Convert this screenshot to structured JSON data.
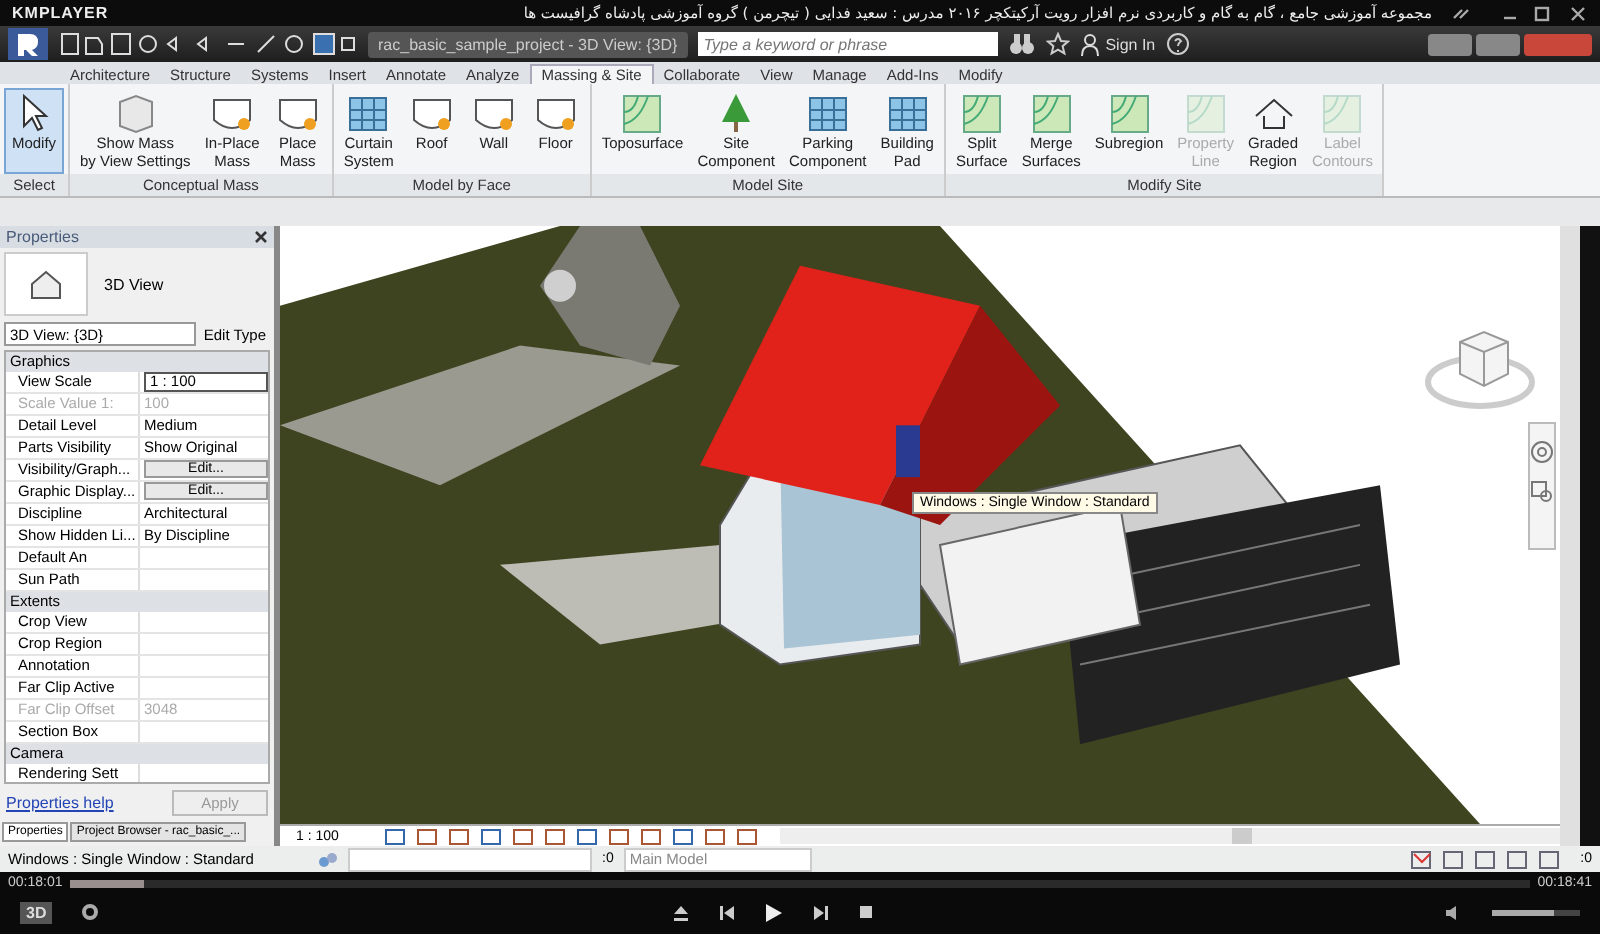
{
  "player": {
    "brand": "KMPLAYER",
    "title": "مجموعه آموزشی جامع ، گام به گام و کاربردی نرم افزار رویت آرکیتکچر ۲۰۱۶   مدرس : سعید فدایی ( تیچرمن ) گروه آموزشی پادشاه گرافیست ها",
    "time_elapsed": "00:18:01",
    "time_total": "00:18:41",
    "progress": {
      "level": 0.05
    },
    "volume": {
      "level": 0.7
    },
    "mode_button": "3D"
  },
  "revit": {
    "document_tab": "rac_basic_sample_project - 3D View: {3D}",
    "search": {
      "placeholder": "Type a keyword or phrase"
    },
    "sign_in": "Sign In",
    "tabs": [
      {
        "label": "Architecture",
        "selected": false
      },
      {
        "label": "Structure",
        "selected": false
      },
      {
        "label": "Systems",
        "selected": false
      },
      {
        "label": "Insert",
        "selected": false
      },
      {
        "label": "Annotate",
        "selected": false
      },
      {
        "label": "Analyze",
        "selected": false
      },
      {
        "label": "Massing & Site",
        "selected": true
      },
      {
        "label": "Collaborate",
        "selected": false
      },
      {
        "label": "View",
        "selected": false
      },
      {
        "label": "Manage",
        "selected": false
      },
      {
        "label": "Add-Ins",
        "selected": false
      },
      {
        "label": "Modify",
        "selected": false
      }
    ],
    "ribbon": [
      {
        "label": "Select",
        "buttons": [
          {
            "label": "Modify",
            "selected": true,
            "disabled": false
          }
        ]
      },
      {
        "label": "Conceptual Mass",
        "buttons": [
          {
            "label": "Show Mass\nby View Settings",
            "selected": false,
            "disabled": false
          },
          {
            "label": "In-Place\nMass",
            "selected": false,
            "disabled": false
          },
          {
            "label": "Place\nMass",
            "selected": false,
            "disabled": false
          }
        ]
      },
      {
        "label": "Model by Face",
        "buttons": [
          {
            "label": "Curtain\nSystem",
            "selected": false,
            "disabled": false
          },
          {
            "label": "Roof",
            "selected": false,
            "disabled": false
          },
          {
            "label": "Wall",
            "selected": false,
            "disabled": false
          },
          {
            "label": "Floor",
            "selected": false,
            "disabled": false
          }
        ]
      },
      {
        "label": "Model Site",
        "buttons": [
          {
            "label": "Toposurface",
            "selected": false,
            "disabled": false
          },
          {
            "label": "Site\nComponent",
            "selected": false,
            "disabled": false
          },
          {
            "label": "Parking\nComponent",
            "selected": false,
            "disabled": false
          },
          {
            "label": "Building\nPad",
            "selected": false,
            "disabled": false
          }
        ]
      },
      {
        "label": "Modify Site",
        "buttons": [
          {
            "label": "Split\nSurface",
            "selected": false,
            "disabled": false
          },
          {
            "label": "Merge\nSurfaces",
            "selected": false,
            "disabled": false
          },
          {
            "label": "Subregion",
            "selected": false,
            "disabled": false
          },
          {
            "label": "Property\nLine",
            "selected": false,
            "disabled": true
          },
          {
            "label": "Graded\nRegion",
            "selected": false,
            "disabled": false
          },
          {
            "label": "Label\nContours",
            "selected": false,
            "disabled": true
          }
        ]
      }
    ],
    "properties": {
      "title": "Properties",
      "type_name": "3D View",
      "selector": "3D View: {3D}",
      "edit_type": "Edit Type",
      "help": "Properties help",
      "apply": "Apply",
      "rows": [
        {
          "kind": "section",
          "name": "Graphics"
        },
        {
          "kind": "field",
          "name": "View Scale",
          "value": "1 : 100",
          "disabled": false
        },
        {
          "kind": "param",
          "name": "Scale Value    1:",
          "value": "100",
          "disabled": true
        },
        {
          "kind": "param",
          "name": "Detail Level",
          "value": "Medium",
          "disabled": false
        },
        {
          "kind": "param",
          "name": "Parts Visibility",
          "value": "Show Original",
          "disabled": false
        },
        {
          "kind": "button",
          "name": "Visibility/Graph...",
          "value": "Edit...",
          "disabled": false
        },
        {
          "kind": "button",
          "name": "Graphic Display...",
          "value": "Edit...",
          "disabled": false
        },
        {
          "kind": "param",
          "name": "Discipline",
          "value": "Architectural",
          "disabled": false
        },
        {
          "kind": "param",
          "name": "Show Hidden Li...",
          "value": "By Discipline",
          "disabled": false
        },
        {
          "kind": "param",
          "name": "Default An",
          "disabled": false
        },
        {
          "kind": "param",
          "name": "Sun Path",
          "disabled": false
        },
        {
          "kind": "section",
          "name": "Extents"
        },
        {
          "kind": "param",
          "name": "Crop View",
          "disabled": false
        },
        {
          "kind": "param",
          "name": "Crop Region",
          "disabled": false
        },
        {
          "kind": "param",
          "name": "Annotation",
          "disabled": false
        },
        {
          "kind": "param",
          "name": "Far Clip Active",
          "disabled": false
        },
        {
          "kind": "param",
          "name": "Far Clip Offset",
          "value": "3048",
          "disabled": true
        },
        {
          "kind": "param",
          "name": "Section Box",
          "disabled": false
        },
        {
          "kind": "section",
          "name": "Camera"
        },
        {
          "kind": "param",
          "name": "Rendering Sett",
          "disabled": false
        }
      ],
      "panel_tabs": [
        {
          "label": "Properties",
          "selected": true
        },
        {
          "label": "Project Browser - rac_basic_...",
          "selected": false
        }
      ]
    },
    "tooltip": "Windows : Single Window : Standard",
    "view_scale": "1 : 100",
    "status": {
      "text": "Windows : Single Window : Standard",
      "count": ":0",
      "model": "Main Model",
      "filter_count": ":0"
    }
  }
}
